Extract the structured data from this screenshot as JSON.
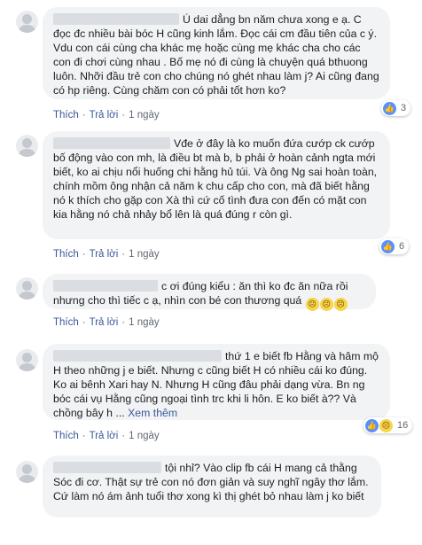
{
  "actions": {
    "like": "Thích",
    "reply": "Trả lời",
    "dot": "·"
  },
  "comments": [
    {
      "text": "Ú dai dẳng bn năm chưa xong e ạ. C đọc đc nhiều bài bóc H cũng kinh lắm. Đọc cái cm đầu tiên của c ý. Vdu con cái cùng cha khác mẹ hoặc cùng mẹ khác cha cho các con đi chơi cùng nhau . Bố mẹ nó đi cùng là chuyện quá bthuong luôn. Nhỡi đầu trẻ con cho chúng nó ghét nhau làm j? Ai cũng đang có hp riêng. Cùng chăm con có phải tốt hơn ko?",
      "time": "1 ngày",
      "reaction_count": "3",
      "reaction_icons": [
        "like-icon"
      ]
    },
    {
      "text": "Vđe ở đây là ko muốn đứa cướp ck cướp bố động vào con mh, là điều bt mà b, b phải ở hoàn cảnh ngta mới biết, ko ai chịu nổi huống chi hằng hủ túi. Và ông Ng sai hoàn toàn, chính mồm ông nhận cả năm k chu cấp cho con, mà đã biết hằng nó k thích cho gặp con Xà thì cứ cố tình đưa con đến có mặt con kia hằng nó chả nhảy bổ lên là quá đúng r còn gì.",
      "time": "1 ngày",
      "reaction_count": "6",
      "reaction_icons": [
        "like-icon"
      ]
    },
    {
      "text": "c ơi đúng kiểu : ăn thì ko đc ăn nữa rồi nhưng cho thì tiếc c ạ, nhìn con bé con thương quá",
      "time": "1 ngày",
      "inline_emoji": [
        "sad-face-icon",
        "sad-face-icon",
        "sad-face-icon"
      ]
    },
    {
      "text": "thứ 1 e biết fb Hằng và hâm mộ H theo những j e biết. Nhưng c cũng biết H có nhiều cái ko đúng. Ko ai bênh Xari hay N. Nhưng H cũng đâu phải dạng vừa. Bn ng bóc cái vụ Hằng cũng ngoại tình trc khi li hôn. E ko biết à?? Và chồng bây h ...",
      "see_more": "Xem thêm",
      "time": "1 ngày",
      "reaction_count": "16",
      "reaction_icons": [
        "like-icon",
        "sad-face-icon"
      ]
    },
    {
      "text": "tội nhỉ? Vào clip fb cái H mang cả thằng Sóc đi cơ. Thật sự trẻ con nó đơn giản và suy nghĩ ngây thơ lắm. Cứ làm nó ám ảnh tuổi thơ xong kì thị ghét bỏ nhau làm j ko biết"
    }
  ]
}
